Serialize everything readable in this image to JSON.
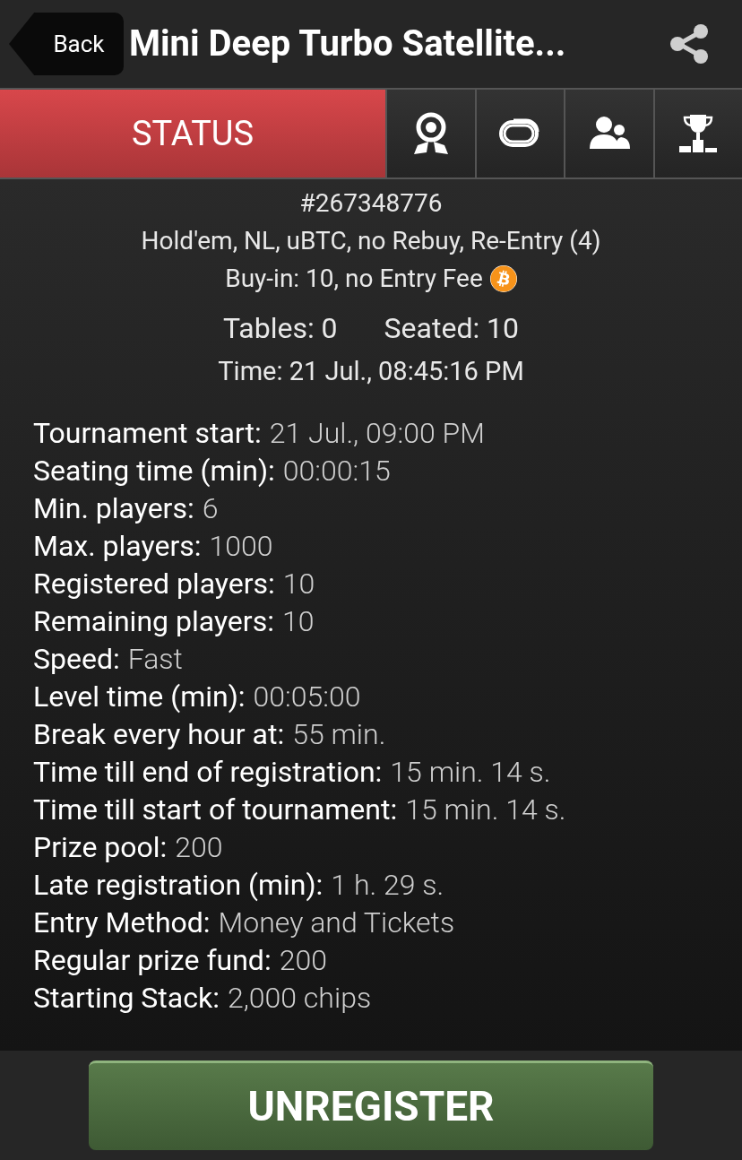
{
  "header": {
    "back": "Back",
    "title": "Mini Deep Turbo Satellite..."
  },
  "tabs": [
    {
      "kind": "text",
      "label": "STATUS",
      "selected": true
    },
    {
      "kind": "award",
      "selected": false
    },
    {
      "kind": "table",
      "selected": false
    },
    {
      "kind": "players",
      "selected": false
    },
    {
      "kind": "prizes",
      "selected": false
    }
  ],
  "summary": {
    "id": "#267348776",
    "game": "Hold'em, NL, uBTC, no Rebuy, Re-Entry (4)",
    "buyin": "Buy-in: 10, no Entry Fee",
    "tables": "Tables: 0",
    "seated": "Seated: 10",
    "time": "Time: 21 Jul., 08:45:16 PM"
  },
  "details": [
    {
      "label": "Tournament start:",
      "value": "21 Jul., 09:00 PM"
    },
    {
      "label": "Seating time (min):",
      "value": "00:00:15"
    },
    {
      "label": "Min. players:",
      "value": "6"
    },
    {
      "label": "Max. players:",
      "value": "1000"
    },
    {
      "label": "Registered players:",
      "value": "10"
    },
    {
      "label": "Remaining players:",
      "value": "10"
    },
    {
      "label": "Speed:",
      "value": "Fast"
    },
    {
      "label": "Level time (min):",
      "value": "00:05:00"
    },
    {
      "label": "Break every hour at:",
      "value": "55 min."
    },
    {
      "label": "Time till end of registration:",
      "value": "15 min. 14 s."
    },
    {
      "label": "Time till start of tournament:",
      "value": "15 min. 14 s."
    },
    {
      "label": "Prize pool:",
      "value": "200"
    },
    {
      "label": "Late registration (min):",
      "value": "1 h. 29 s."
    },
    {
      "label": "Entry Method:",
      "value": "Money and Tickets"
    },
    {
      "label": "Regular prize fund:",
      "value": "200"
    },
    {
      "label": "Starting Stack:",
      "value": "2,000 chips"
    }
  ],
  "action": "UNREGISTER"
}
